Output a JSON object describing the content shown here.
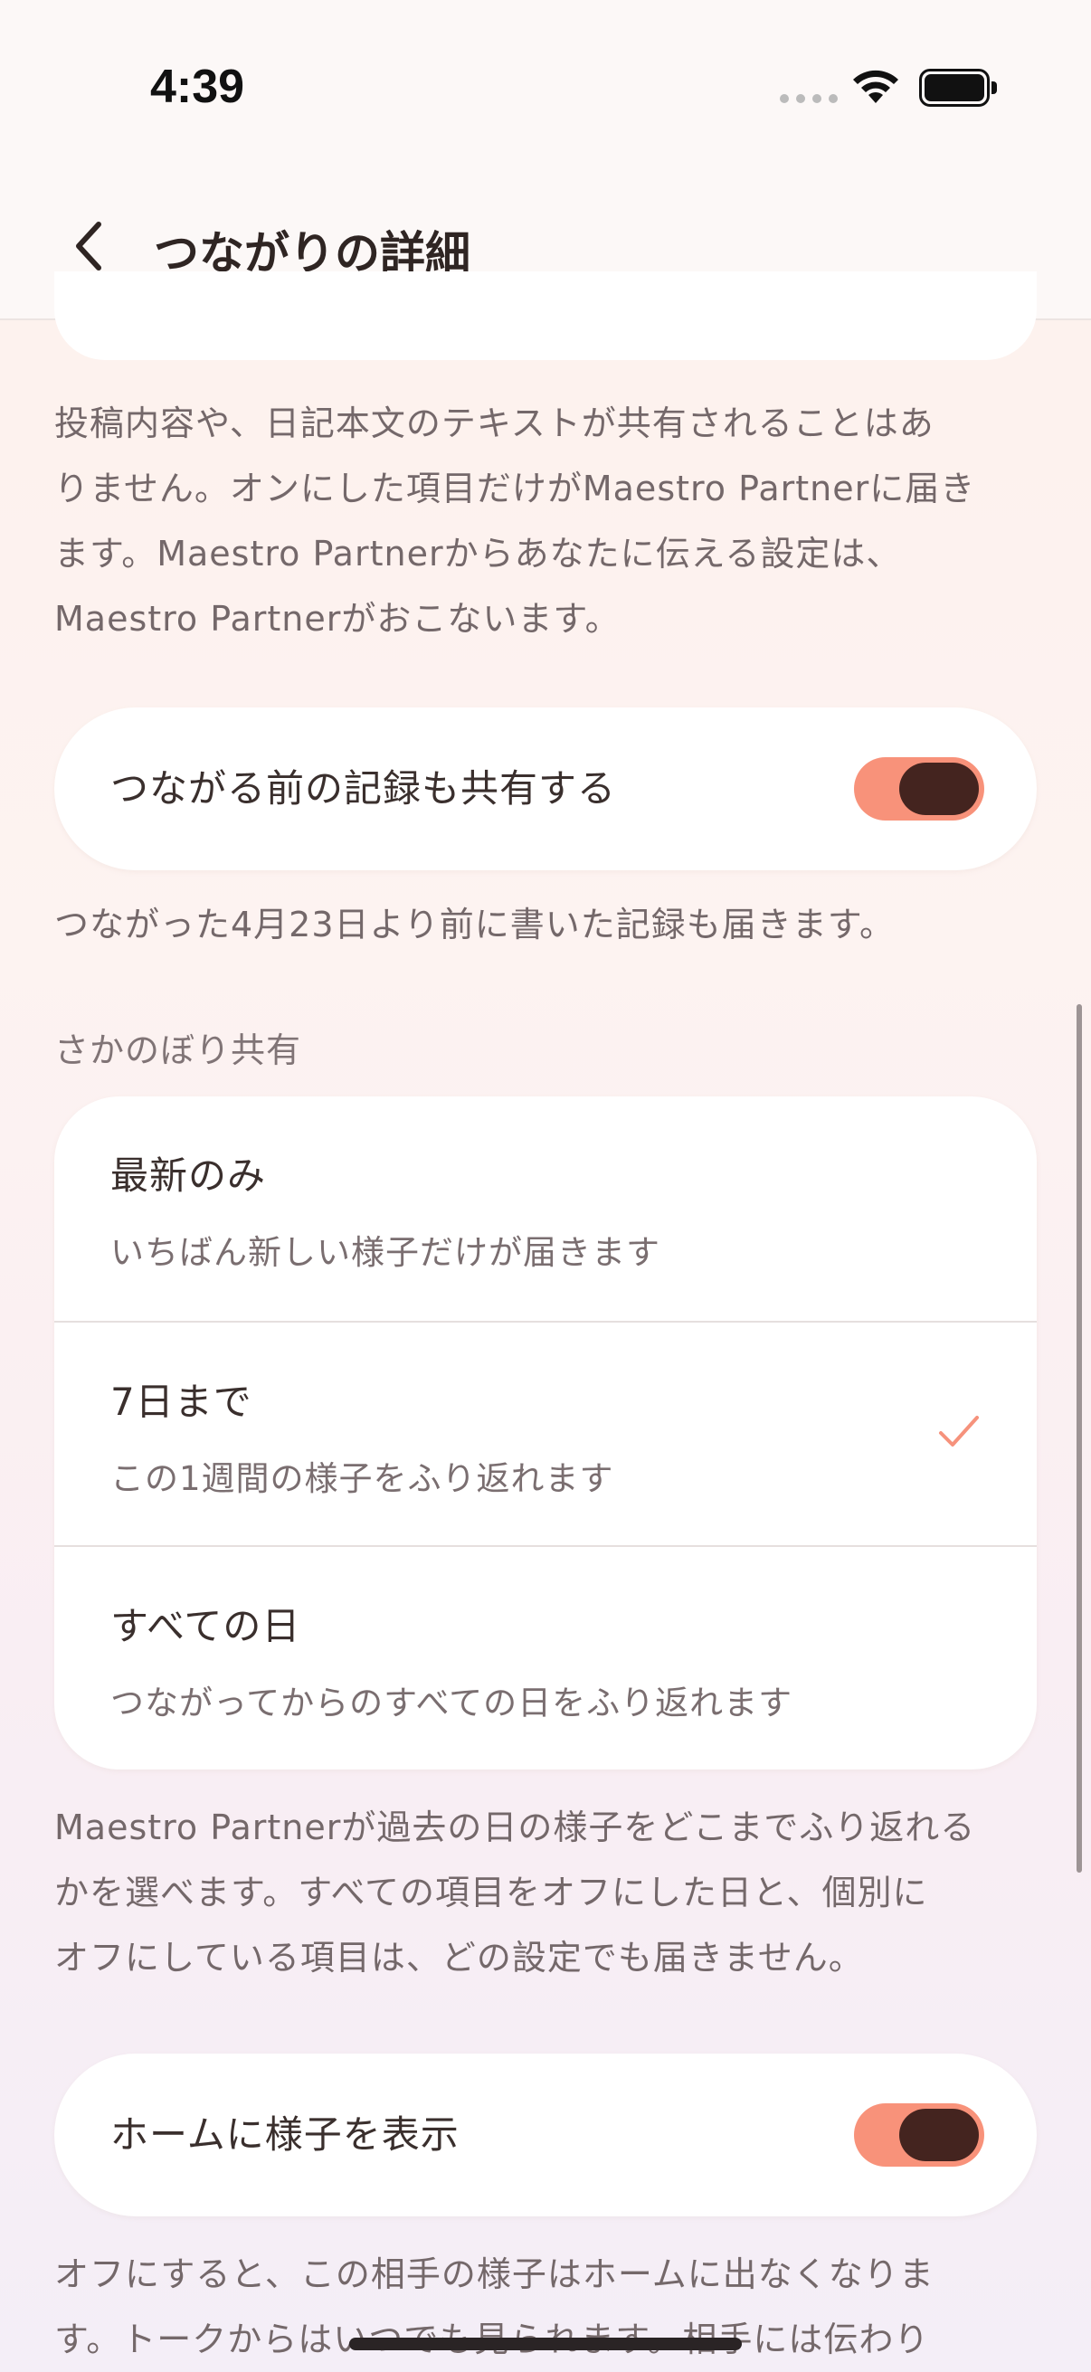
{
  "status_bar": {
    "time": "4:39"
  },
  "nav": {
    "title": "つながりの詳細"
  },
  "intro_lines": [
    "投稿内容や、日記本文のテキストが共有されることはあ",
    "りません。オンにした項目だけがMaestro Partnerに届き",
    "ます。Maestro Partnerからあなたに伝える設定は、",
    "Maestro Partnerがおこないます。"
  ],
  "share_before": {
    "label": "つながる前の記録も共有する",
    "enabled": true,
    "note": "つながった4月23日より前に書いた記録も届きます。"
  },
  "retro_share": {
    "header": "さかのぼり共有",
    "options": [
      {
        "title": "最新のみ",
        "subtitle": "いちばん新しい様子だけが届きます",
        "selected": false
      },
      {
        "title": "7日まで",
        "subtitle": "この1週間の様子をふり返れます",
        "selected": true
      },
      {
        "title": "すべての日",
        "subtitle": "つながってからのすべての日をふり返れます",
        "selected": false
      }
    ],
    "note_lines": [
      "Maestro Partnerが過去の日の様子をどこまでふり返れる",
      "かを選べます。すべての項目をオフにした日と、個別に",
      "オフにしている項目は、どの設定でも届きません。"
    ]
  },
  "home_display": {
    "label": "ホームに様子を表示",
    "enabled": true,
    "note_lines": [
      "オフにすると、この相手の様子はホームに出なくなりま",
      "す。トークからはいつでも見られます。相手には伝わり"
    ]
  },
  "colors": {
    "toggle_track": "#f8927a",
    "toggle_knob": "#44241f",
    "check": "#f6927c"
  }
}
